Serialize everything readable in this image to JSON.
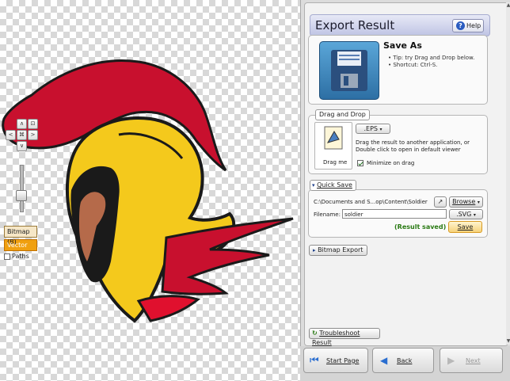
{
  "canvas": {
    "nav_pad": {
      "up": "∧",
      "down": "∨",
      "left": "<",
      "right": ">",
      "center": "⌘",
      "fit": "⊡"
    },
    "modes": {
      "bitmap": "Bitmap (B)",
      "vector": "Vector (V)",
      "paths": "Paths",
      "active": "vector"
    },
    "colors": {
      "helmet_yellow": "#f4c91c",
      "crest_red": "#c8102e",
      "outline": "#1a1a1a",
      "mode_active": "#f0a010"
    }
  },
  "panel": {
    "title": "Export Result",
    "help_label": "Help",
    "save_as": {
      "title": "Save As",
      "tip1": "• Tip: try Drag and Drop below.",
      "tip2": "• Shortcut: Ctrl-S."
    },
    "drag_drop": {
      "label": "Drag and Drop",
      "format": ".EPS",
      "hint1": "Drag the result to another application, or",
      "hint2": "Double click to open in default viewer",
      "drag_me": "Drag me",
      "minimize_label": "Minimize on drag",
      "minimize_checked": true
    },
    "quick_save": {
      "label": "Quick Save",
      "path": "C:\\Documents and S...op\\Content\\Soldier",
      "browse": "Browse",
      "filename_label": "Filename:",
      "filename": "soldier",
      "format": ".SVG",
      "status": "(Result saved)",
      "save": "Save"
    },
    "bitmap_export": "Bitmap Export",
    "troubleshoot": "Troubleshoot Result"
  },
  "footer": {
    "start": "Start Page",
    "back": "Back",
    "next": "Next"
  }
}
